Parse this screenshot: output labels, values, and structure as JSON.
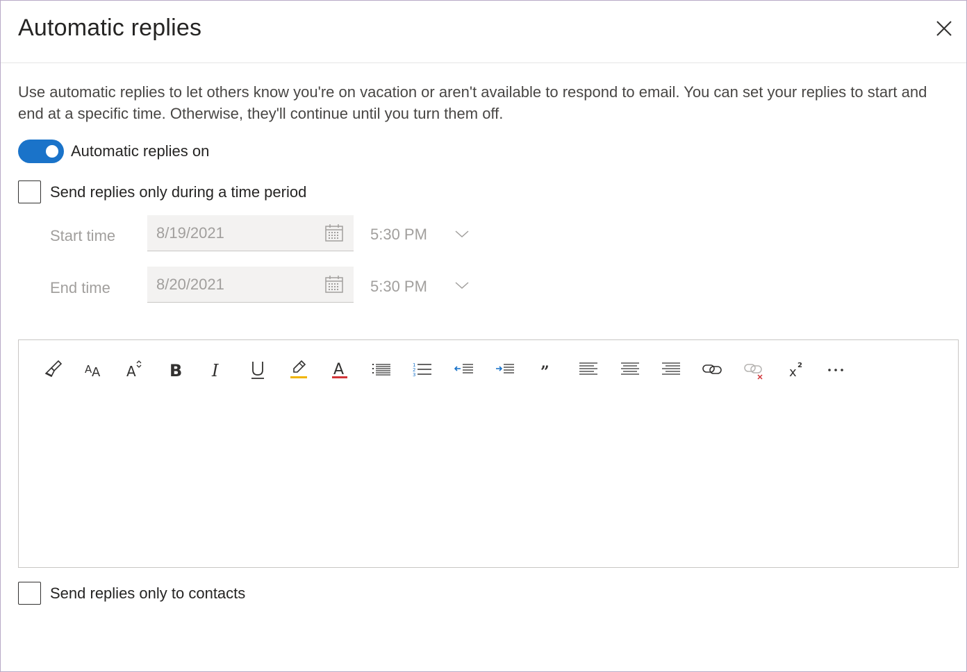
{
  "dialog": {
    "title": "Automatic replies",
    "description": "Use automatic replies to let others know you're on vacation or aren't available to respond to email. You can set your replies to start and end at a specific time. Otherwise, they'll continue until you turn them off."
  },
  "toggle": {
    "label": "Automatic replies on",
    "checked": true,
    "accent": "#1a73c9"
  },
  "time_period": {
    "label": "Send replies only during a time period",
    "checked": false,
    "start": {
      "label": "Start time",
      "date": "8/19/2021",
      "time": "5:30 PM"
    },
    "end": {
      "label": "End time",
      "date": "8/20/2021",
      "time": "5:30 PM"
    }
  },
  "toolbar": {
    "buttons": [
      "format-painter-icon",
      "font-icon",
      "font-size-icon",
      "bold-icon",
      "italic-icon",
      "underline-icon",
      "highlight-icon",
      "font-color-icon",
      "bullets-icon",
      "numbering-icon",
      "decrease-indent-icon",
      "increase-indent-icon",
      "quote-icon",
      "align-left-icon",
      "align-center-icon",
      "align-right-icon",
      "insert-link-icon",
      "remove-link-icon",
      "superscript-icon",
      "more-options-icon"
    ],
    "highlight_color": "#f0b400",
    "font_color": "#d13438",
    "indent_arrow_color": "#1a73c9"
  },
  "contacts": {
    "label": "Send replies only to contacts",
    "checked": false
  }
}
